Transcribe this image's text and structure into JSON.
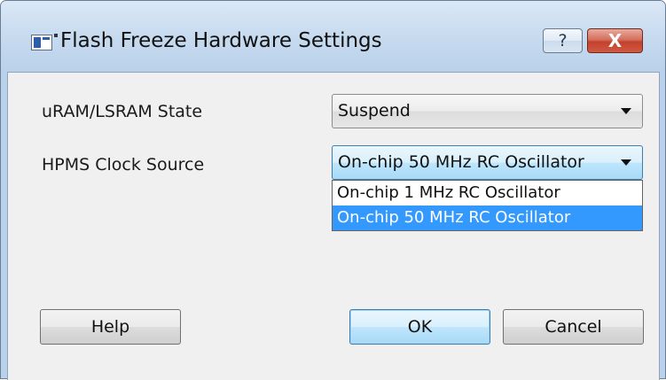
{
  "window": {
    "title": "Flash Freeze Hardware Settings",
    "help_glyph": "?",
    "close_glyph": "X"
  },
  "form": {
    "uram_label": "uRAM/LSRAM State",
    "uram_value": "Suspend",
    "hpms_label": "HPMS Clock Source",
    "hpms_value": "On-chip 50 MHz RC Oscillator"
  },
  "dropdown": {
    "options": [
      "On-chip 1 MHz RC Oscillator",
      "On-chip 50 MHz RC Oscillator"
    ],
    "selected": "On-chip 50 MHz RC Oscillator"
  },
  "buttons": {
    "help": "Help",
    "ok": "OK",
    "cancel": "Cancel"
  },
  "colors": {
    "selection": "#3399ff",
    "title_bar": "#b9d1ea",
    "close_button": "#c3412d"
  },
  "icons": {
    "app": "window-app-icon",
    "help": "question-mark-icon",
    "close": "close-x-icon",
    "dropdown": "chevron-down-icon"
  }
}
